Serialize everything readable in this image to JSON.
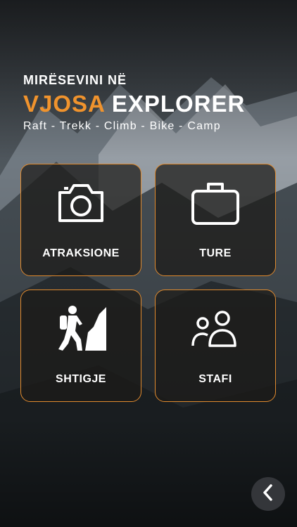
{
  "header": {
    "welcome": "MIRËSEVINI NË",
    "brand_accent": "VJOSA",
    "brand_rest": " EXPLORER",
    "tagline": "Raft - Trekk - Climb - Bike - Camp"
  },
  "tiles": [
    {
      "label": "ATRAKSIONE",
      "icon": "camera-icon"
    },
    {
      "label": "TURE",
      "icon": "briefcase-icon"
    },
    {
      "label": "SHTIGJE",
      "icon": "hiker-icon"
    },
    {
      "label": "STAFI",
      "icon": "people-icon"
    }
  ],
  "nav": {
    "back_icon": "chevron-left-icon"
  },
  "colors": {
    "accent": "#f0932d",
    "tile_border": "#e08a2e"
  }
}
